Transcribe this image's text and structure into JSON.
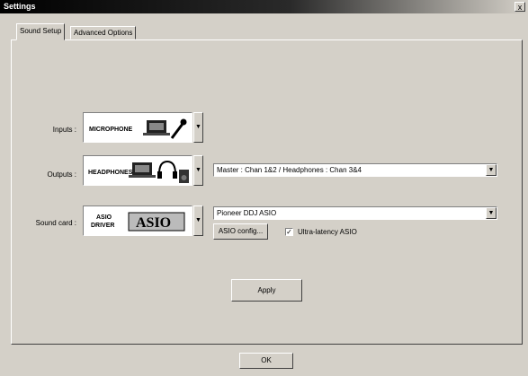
{
  "window": {
    "title": "Settings",
    "close_label": "x"
  },
  "tabs": [
    {
      "label": "Sound Setup",
      "active": true
    },
    {
      "label": "Advanced Options",
      "active": false
    }
  ],
  "inputs": {
    "label": "Inputs :",
    "image_text": "MICROPHONE"
  },
  "outputs": {
    "label": "Outputs :",
    "image_text": "HEADPHONES",
    "selected": "Master : Chan 1&2 / Headphones : Chan 3&4"
  },
  "sound_card": {
    "label": "Sound card :",
    "image_text_line1": "ASIO",
    "image_text_line2": "DRIVER",
    "image_logo": "ASIO",
    "selected": "Pioneer DDJ ASIO",
    "asio_config_label": "ASIO config...",
    "ultra_latency_label": "Ultra-latency ASIO",
    "ultra_latency_checked": true
  },
  "apply_label": "Apply",
  "ok_label": "OK"
}
